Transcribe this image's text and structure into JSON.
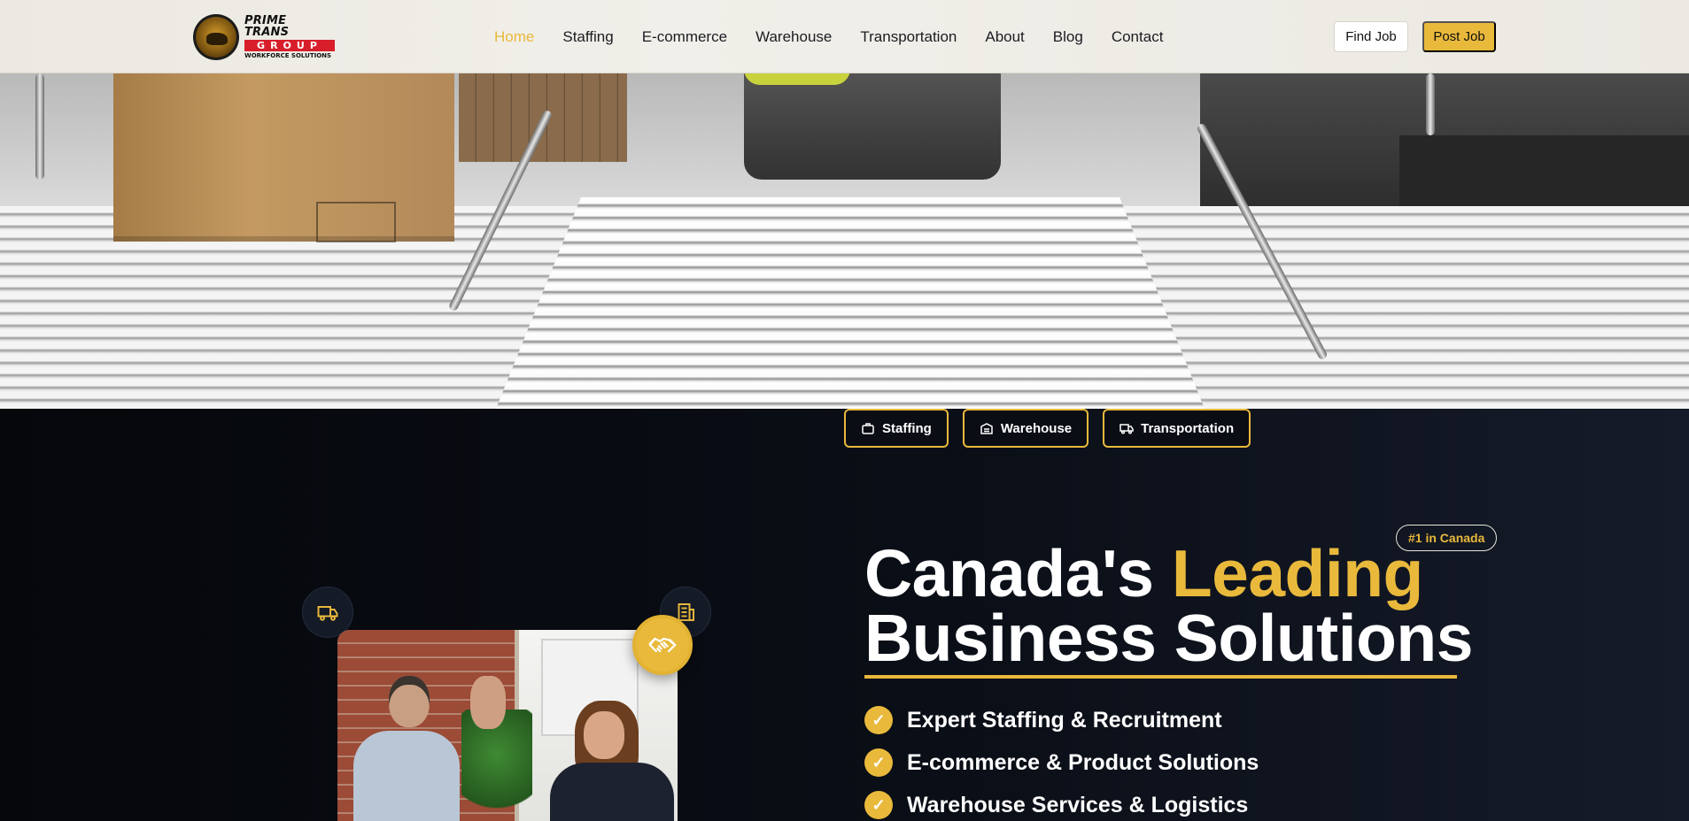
{
  "header": {
    "logo": {
      "line1": "PRIME TRANS",
      "line2": "GROUP",
      "line3": "WORKFORCE SOLUTIONS"
    },
    "nav": [
      {
        "label": "Home",
        "active": true
      },
      {
        "label": "Staffing"
      },
      {
        "label": "E-commerce"
      },
      {
        "label": "Warehouse"
      },
      {
        "label": "Transportation"
      },
      {
        "label": "About"
      },
      {
        "label": "Blog"
      },
      {
        "label": "Contact"
      }
    ],
    "find_job": "Find Job",
    "post_job": "Post Job"
  },
  "hero": {
    "image": "warehouse conveyor rollers with cardboard box"
  },
  "chips": [
    {
      "label": "Staffing",
      "icon": "briefcase-icon"
    },
    {
      "label": "Warehouse",
      "icon": "warehouse-icon"
    },
    {
      "label": "Transportation",
      "icon": "truck-icon"
    }
  ],
  "main": {
    "badge": "#1 in Canada",
    "headline_part1": "Canada's ",
    "headline_accent": "Leading",
    "headline_part2": "Business Solutions",
    "features": [
      "Expert Staffing & Recruitment",
      "E-commerce & Product Solutions",
      "Warehouse Services & Logistics"
    ]
  },
  "visual": {
    "icons": [
      "truck-icon",
      "building-icon",
      "handshake-icon"
    ],
    "photo": "two business people giving a high five"
  },
  "colors": {
    "accent": "#e9b93c",
    "dark_bg": "#07090f",
    "header_bg": "#efede7"
  }
}
